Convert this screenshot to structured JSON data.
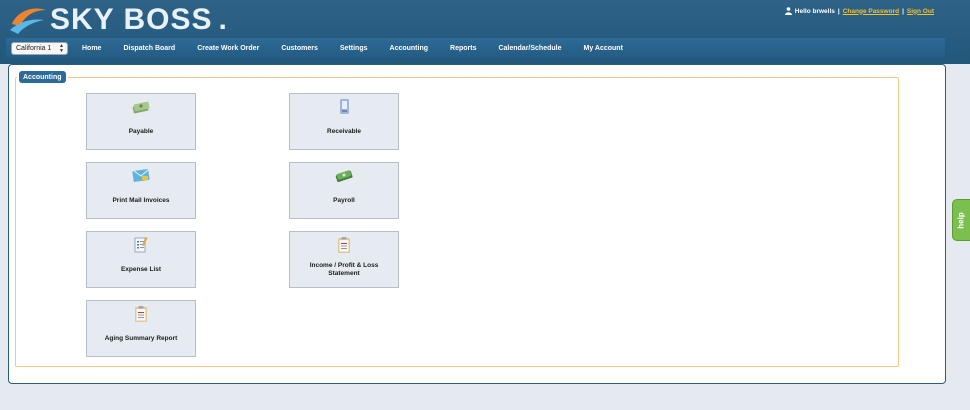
{
  "header": {
    "logo_text": "SKY BOSS",
    "logo_dot": ".",
    "greeting": "Hello brwells",
    "change_password": "Change Password",
    "sign_out": "Sign Out",
    "separator": "|"
  },
  "navbar": {
    "location": "California 1",
    "items": [
      "Home",
      "Dispatch Board",
      "Create Work Order",
      "Customers",
      "Settings",
      "Accounting",
      "Reports",
      "Calendar/Schedule",
      "My Account"
    ]
  },
  "section": {
    "title": "Accounting"
  },
  "tiles": [
    {
      "label": "Payable",
      "icon": "money-stack-icon"
    },
    {
      "label": "Receivable",
      "icon": "receipt-icon"
    },
    {
      "label": "Print Mail Invoices",
      "icon": "mail-invoice-icon"
    },
    {
      "label": "Payroll",
      "icon": "cash-icon"
    },
    {
      "label": "Expense List",
      "icon": "checklist-pencil-icon"
    },
    {
      "label": "Income / Profit & Loss Statement",
      "icon": "clipboard-report-icon"
    },
    {
      "label": "Aging Summary Report",
      "icon": "clipboard-report-icon"
    }
  ],
  "help": {
    "label": "help"
  },
  "colors": {
    "header_bg": "#2f6287",
    "nav_bg": "#2d6a95",
    "link_accent": "#f2c12e",
    "section_badge": "#2c6a9a",
    "frame_border": "#f1c98a",
    "help_tab": "#7bbf4e"
  }
}
